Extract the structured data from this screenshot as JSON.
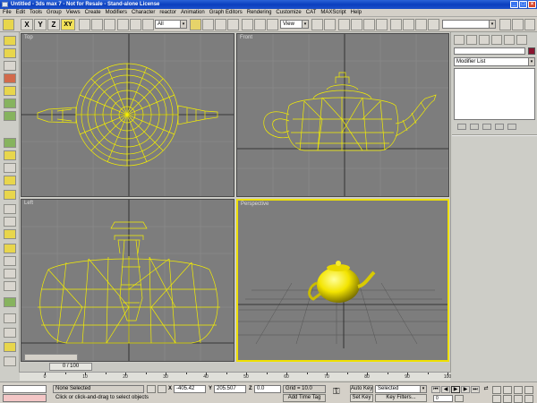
{
  "window": {
    "title": "Untitled - 3ds max 7 - Not for Resale - Stand-alone License"
  },
  "menu": [
    "File",
    "Edit",
    "Tools",
    "Group",
    "Views",
    "Create",
    "Modifiers",
    "Character",
    "reactor",
    "Animation",
    "Graph Editors",
    "Rendering",
    "Customize",
    "CAT",
    "MAXScript",
    "Help"
  ],
  "toolbar": {
    "axis_x": "X",
    "axis_y": "Y",
    "axis_z": "Z",
    "axis_xy": "XY",
    "filter_value": "All",
    "view_value": "View"
  },
  "viewports": {
    "top": "Top",
    "front": "Front",
    "left": "Left",
    "perspective": "Perspective"
  },
  "command_panel": {
    "modifier_list": "Modifier List"
  },
  "timeline": {
    "frame_readout": "0 / 100",
    "ticks": [
      "0",
      "10",
      "20",
      "30",
      "40",
      "50",
      "60",
      "70",
      "80",
      "90",
      "100"
    ]
  },
  "status": {
    "selection": "None Selected",
    "prompt": "Click or click-and-drag to select objects",
    "x_label": "X",
    "x_value": "-405.42",
    "y_label": "Y",
    "y_value": "205.507",
    "z_label": "Z",
    "z_value": "0.0",
    "grid": "Grid = 10.0",
    "add_time_tag": "Add Time Tag",
    "auto_key": "Auto Key",
    "set_key": "Set Key",
    "selected_dropdown": "Selected",
    "key_filters": "Key Filters...",
    "frame_value": "0"
  },
  "colors": {
    "wire": "#f4ee00",
    "viewport_bg": "#7d7d7d",
    "grid": "#8f8f8f",
    "active_border": "#eee000"
  }
}
